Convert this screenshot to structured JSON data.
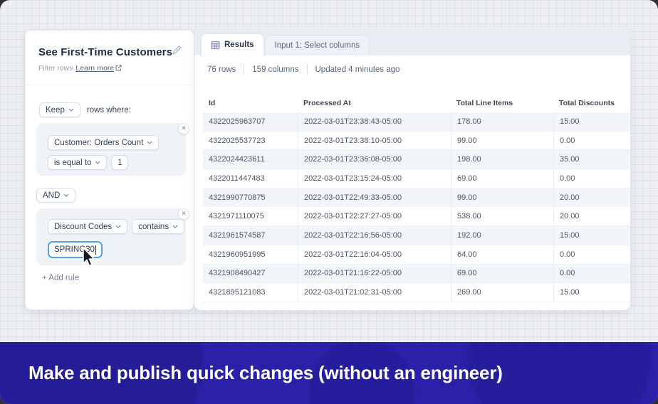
{
  "left_panel": {
    "title": "See First-Time Customers",
    "subtitle": "Filter rows",
    "learn_more_label": "Learn more",
    "keep_label": "Keep",
    "rows_where_label": "rows where:",
    "and_label": "AND",
    "add_rule_label": "+ Add rule",
    "rule1": {
      "field": "Customer: Orders Count",
      "operator": "is equal to",
      "value": "1"
    },
    "rule2": {
      "field": "Discount Codes",
      "operator": "contains",
      "value": "SPRING30"
    }
  },
  "tabs": [
    {
      "label": "Results",
      "active": true
    },
    {
      "label": "Input 1: Select columns",
      "active": false
    }
  ],
  "status": {
    "rows": "76 rows",
    "columns": "159 columns",
    "updated": "Updated 4 minutes ago"
  },
  "table": {
    "headers": [
      "Id",
      "Processed At",
      "Total Line Items",
      "Total Discounts"
    ],
    "rows": [
      [
        "4322025963707",
        "2022-03-01T23:38:43-05:00",
        "178.00",
        "15.00"
      ],
      [
        "4322025537723",
        "2022-03-01T23:38:10-05:00",
        "99.00",
        "0.00"
      ],
      [
        "4322024423611",
        "2022-03-01T23:36:08-05:00",
        "198.00",
        "35.00"
      ],
      [
        "4322011447483",
        "2022-03-01T23:15:24-05:00",
        "69.00",
        "0.00"
      ],
      [
        "4321990770875",
        "2022-03-01T22:49:33-05:00",
        "99.00",
        "20.00"
      ],
      [
        "4321971110075",
        "2022-03-01T22:27:27-05:00",
        "538.00",
        "20.00"
      ],
      [
        "4321961574587",
        "2022-03-01T22:16:56-05:00",
        "192.00",
        "15.00"
      ],
      [
        "4321960951995",
        "2022-03-01T22:16:04-05:00",
        "64.00",
        "0.00"
      ],
      [
        "4321908490427",
        "2022-03-01T21:16:22-05:00",
        "69.00",
        "0.00"
      ],
      [
        "4321895121083",
        "2022-03-01T21:02:31-05:00",
        "269.00",
        "15.00"
      ]
    ]
  },
  "banner": {
    "text": "Make and publish quick changes (without an engineer)",
    "background": "#2b21a8",
    "text_color": "#ffffff"
  },
  "icons": {
    "close_glyph": "×",
    "edit": "pencil-icon",
    "external_link": "external-link-icon",
    "results_tab": "table-icon",
    "chevron": "chevron-down-icon",
    "mouse": "mouse-cursor"
  },
  "colors": {
    "canvas_background": "#edeff3",
    "card_background": "#ffffff",
    "tab_strip": "#e8ecf3",
    "rule_card": "#eff3f8",
    "focused_input_border": "#55a1e6",
    "banner": "#2b21a8",
    "zebra_row": "#f2f6fa"
  }
}
